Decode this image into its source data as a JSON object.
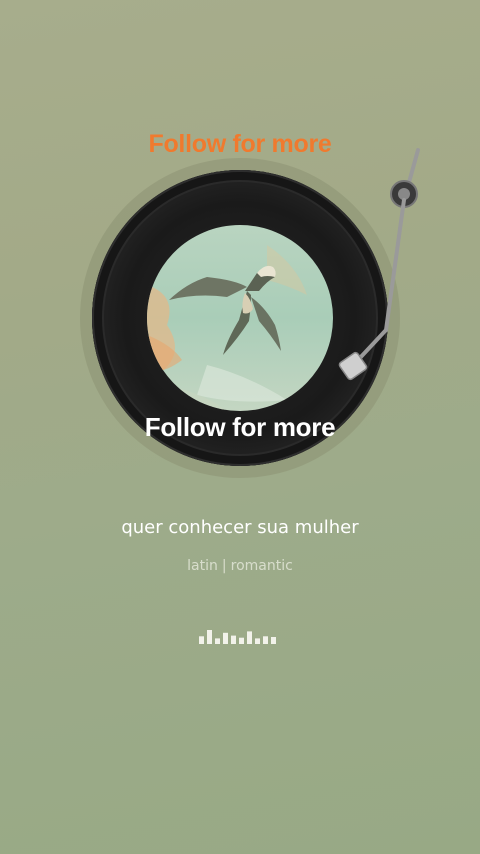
{
  "overlay": {
    "top_text": "Follow for more",
    "center_text": "Follow for more",
    "top_color": "#f07a2e"
  },
  "track": {
    "title": "quer conhecer sua mulher",
    "genre": "latin",
    "separator": "|",
    "mood": "romantic"
  },
  "player": {
    "record_art": "swallow-bird-painting",
    "tonearm_icon": "turntable-tonearm-icon",
    "equalizer_icon": "audio-equalizer-icon",
    "equalizer_levels": [
      0.55,
      1.0,
      0.4,
      0.8,
      0.6,
      0.45,
      0.9,
      0.4,
      0.55,
      0.5
    ]
  }
}
